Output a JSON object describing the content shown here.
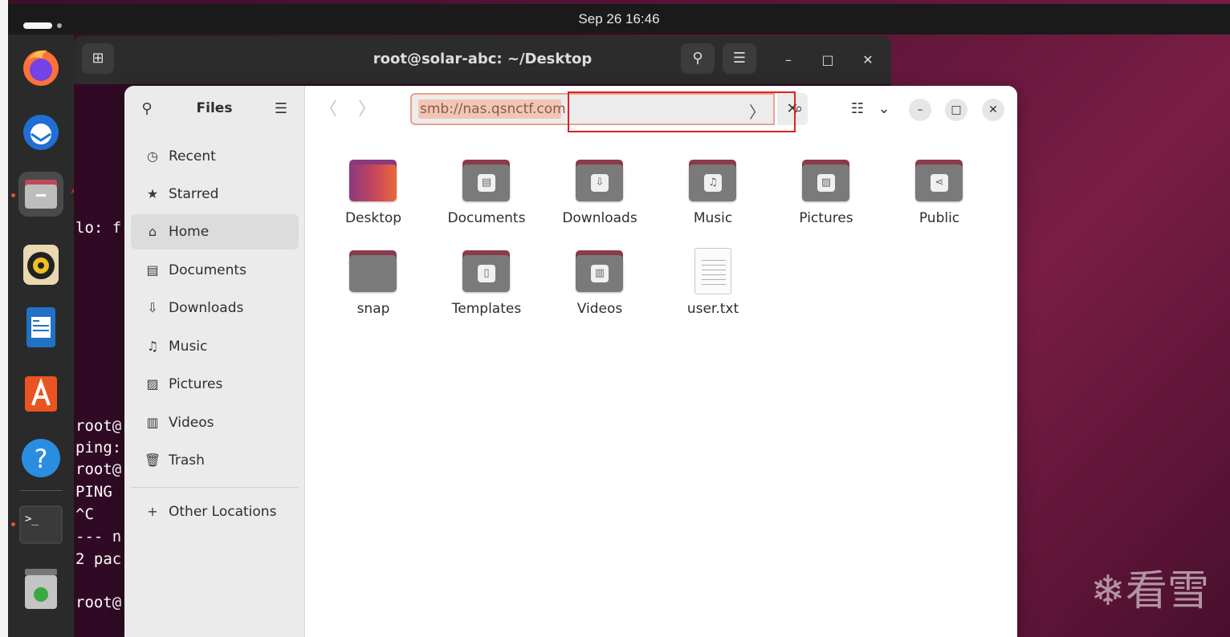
{
  "topbar": {
    "clock": "Sep 26  16:46"
  },
  "dock": {
    "items": [
      {
        "name": "firefox"
      },
      {
        "name": "thunderbird"
      },
      {
        "name": "files"
      },
      {
        "name": "rhythmbox"
      },
      {
        "name": "libreoffice-writer"
      },
      {
        "name": "app-center"
      },
      {
        "name": "help"
      },
      {
        "name": "terminal"
      },
      {
        "name": "trash"
      }
    ]
  },
  "terminal": {
    "title": "root@solar-abc: ~/Desktop",
    "lines": {
      "l1": "lo: f",
      "l2": "root@",
      "l3": "ping:",
      "l4": "root@",
      "l5": "PING",
      "l6": "^C",
      "l7": "--- n",
      "l8": "2 pac",
      "l9": "root@"
    }
  },
  "files": {
    "sidebar": {
      "title": "Files",
      "items": [
        {
          "label": "Recent",
          "icon": "clock-icon"
        },
        {
          "label": "Starred",
          "icon": "star-icon"
        },
        {
          "label": "Home",
          "icon": "home-icon"
        },
        {
          "label": "Documents",
          "icon": "document-icon"
        },
        {
          "label": "Downloads",
          "icon": "download-icon"
        },
        {
          "label": "Music",
          "icon": "music-icon"
        },
        {
          "label": "Pictures",
          "icon": "picture-icon"
        },
        {
          "label": "Videos",
          "icon": "video-icon"
        },
        {
          "label": "Trash",
          "icon": "trash-icon"
        }
      ],
      "other_locations": "Other Locations"
    },
    "path": {
      "value": "smb://nas.qsnctf.com"
    },
    "grid": [
      {
        "label": "Desktop"
      },
      {
        "label": "Documents"
      },
      {
        "label": "Downloads"
      },
      {
        "label": "Music"
      },
      {
        "label": "Pictures"
      },
      {
        "label": "Public"
      },
      {
        "label": "snap"
      },
      {
        "label": "Templates"
      },
      {
        "label": "Videos"
      },
      {
        "label": "user.txt"
      }
    ]
  },
  "watermark": "❄看雪"
}
